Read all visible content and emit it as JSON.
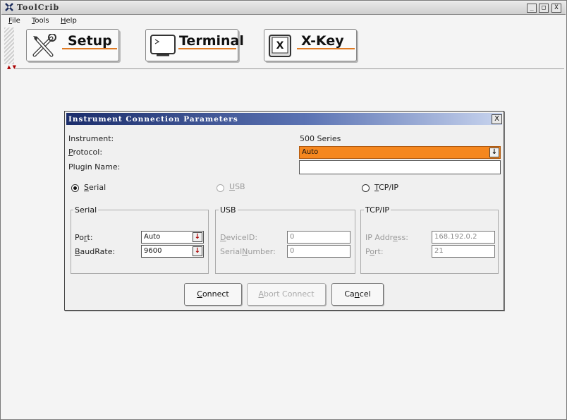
{
  "app": {
    "title": "ToolCrib",
    "icon": "toolcrib-app-icon",
    "window_buttons": [
      "_",
      "□",
      "X"
    ]
  },
  "menu": [
    {
      "label": "File",
      "mnemonic": "F",
      "rest": "ile"
    },
    {
      "label": "Tools",
      "mnemonic": "T",
      "rest": "ools"
    },
    {
      "label": "Help",
      "mnemonic": "H",
      "rest": "elp"
    }
  ],
  "toolbar": {
    "buttons": [
      {
        "label": "Setup",
        "icon": "wrench-screwdriver-icon"
      },
      {
        "label": "Terminal",
        "icon": "terminal-monitor-icon"
      },
      {
        "label": "X-Key",
        "icon": "x-key-icon"
      }
    ],
    "accent_color": "#e07a22"
  },
  "dialog": {
    "title": "Instrument Connection Parameters",
    "close_label": "X",
    "instrument_label": "Instrument:",
    "instrument_value": "500 Series",
    "protocol_label": "Protocol:",
    "protocol_value": "Auto",
    "protocol_highlight_color": "#f5871f",
    "plugin_label": "Plugin Name:",
    "plugin_value": "",
    "connection_types": [
      {
        "label": "Serial",
        "selected": true,
        "enabled": true
      },
      {
        "label": "USB",
        "selected": false,
        "enabled": false
      },
      {
        "label": "TCP/IP",
        "selected": false,
        "enabled": true
      }
    ],
    "serial": {
      "title": "Serial",
      "port_label": "Port:",
      "port_value": "Auto",
      "baud_label": "BaudRate:",
      "baud_value": "9600"
    },
    "usb": {
      "title": "USB",
      "device_label": "DeviceID:",
      "device_value": "0",
      "serial_label": "SerialNumber:",
      "serial_value": "0"
    },
    "tcpip": {
      "title": "TCP/IP",
      "ip_label": "IP Address:",
      "ip_value": "168.192.0.2",
      "port_label": "Port:",
      "port_value": "21"
    },
    "buttons": {
      "connect": "Connect",
      "abort": "Abort Connect",
      "cancel": "Cancel"
    }
  }
}
